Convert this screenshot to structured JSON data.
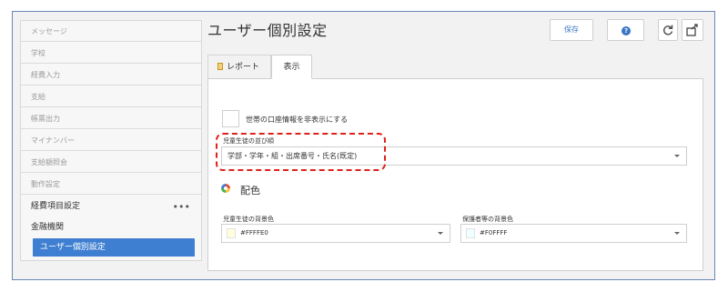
{
  "sidebar": {
    "items": [
      {
        "label": "メッセージ"
      },
      {
        "label": "学校"
      },
      {
        "label": "経費入力"
      },
      {
        "label": "支給"
      },
      {
        "label": "帳票出力"
      },
      {
        "label": "マイナンバー"
      },
      {
        "label": "支給額照会"
      },
      {
        "label": "動作設定"
      },
      {
        "label": "経費項目設定",
        "more": "•••"
      },
      {
        "label": "金融機関"
      },
      {
        "label": "ユーザー個別設定"
      }
    ]
  },
  "header": {
    "title": "ユーザー個別設定",
    "save_label": "保存",
    "help_label": "?"
  },
  "tabs": [
    {
      "label": "レポート"
    },
    {
      "label": "表示"
    }
  ],
  "panel": {
    "hide_account_label": "世帯の口座情報を非表示にする",
    "sort_order": {
      "label": "児童生徒の並び順",
      "value": "学部・学年・組・出席番号・氏名(既定)"
    },
    "color_section_title": "配色",
    "student_bg": {
      "label": "児童生徒の背景色",
      "value": "#FFFFE0",
      "color": "#FFFFE0"
    },
    "guardian_bg": {
      "label": "保護者等の背景色",
      "value": "#F0FFFF",
      "color": "#F0FFFF"
    }
  },
  "colors": {
    "accent": "#3f7fd2",
    "highlight": "#e0201c",
    "frame": "#6a88b4"
  },
  "icons": {
    "report_tab": "document-icon",
    "help": "help-icon",
    "refresh": "refresh-icon",
    "export": "export-icon",
    "palette": "palette-icon"
  }
}
